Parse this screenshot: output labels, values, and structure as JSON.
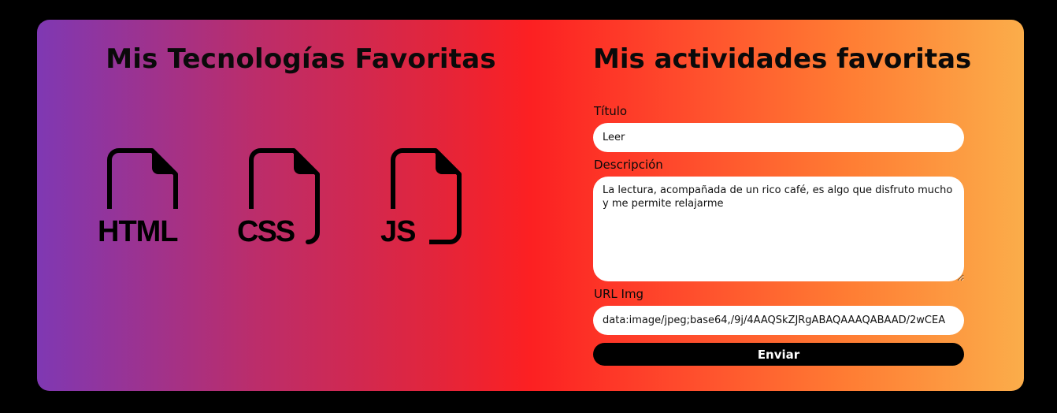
{
  "technologies": {
    "title": "Mis Tecnologías Favoritas",
    "items": [
      {
        "label": "HTML",
        "icon": "html-file-icon"
      },
      {
        "label": "CSS",
        "icon": "css-file-icon"
      },
      {
        "label": "JS",
        "icon": "js-file-icon"
      }
    ]
  },
  "form": {
    "title": "Mis actividades favoritas",
    "title_label": "Título",
    "title_value": "Leer",
    "description_label": "Descripción",
    "description_value": "La lectura, acompañada de un rico café, es algo que disfruto mucho y me permite relajarme",
    "url_label": "URL Img",
    "url_value": "data:image/jpeg;base64,/9j/4AAQSkZJRgABAQAAAQABAAD/2wCEA",
    "submit_label": "Enviar"
  },
  "colors": {
    "gradient_start": "#7f38b3",
    "gradient_mid": "#fc2022",
    "gradient_end": "#fbad4a",
    "button": "#000000"
  }
}
